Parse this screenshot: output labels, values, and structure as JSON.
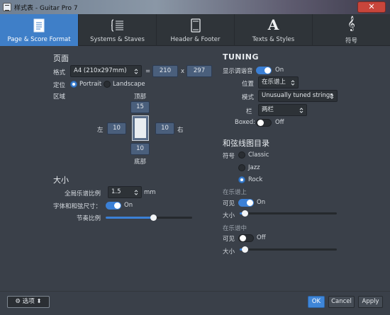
{
  "window": {
    "title": "样式表 - Guitar Pro 7"
  },
  "tabs": [
    {
      "label": "Page & Score Format",
      "icon": "page-icon"
    },
    {
      "label": "Systems & Staves",
      "icon": "systems-icon"
    },
    {
      "label": "Header & Footer",
      "icon": "header-footer-icon"
    },
    {
      "label": "Texts & Styles",
      "icon": "text-a-icon"
    },
    {
      "label": "符号",
      "icon": "treble-clef-icon"
    }
  ],
  "page": {
    "heading": "页面",
    "format_label": "格式",
    "format_value": "A4 (210x297mm)",
    "equals": "=",
    "width": "210",
    "times": "x",
    "height": "297",
    "orientation_label": "定位",
    "portrait": "Portrait",
    "landscape": "Landscape",
    "orientation_selected": "Portrait",
    "margins_label": "区域",
    "top_label": "顶部",
    "top": "15",
    "left_label": "左",
    "left": "10",
    "right_label": "右",
    "right": "10",
    "bottom_label": "底部",
    "bottom": "10"
  },
  "size": {
    "heading": "大小",
    "global_scale_label": "全局乐谱比例",
    "global_scale_value": "1.5",
    "global_scale_unit": "mm",
    "font_chord_label": "字体和和弦尺寸：",
    "font_chord_toggle": "On",
    "rhythm_ratio_label": "节奏比例",
    "rhythm_ratio_fraction": 0.55
  },
  "tuning": {
    "heading": "TUNING",
    "show_label": "显示调谐音",
    "show_toggle": "On",
    "position_label": "位置",
    "position_value": "在乐谱上",
    "mode_label": "模式",
    "mode_value": "Unusually tuned strings",
    "column_label": "栏",
    "column_value": "两栏",
    "boxed_label": "Boxed:",
    "boxed_toggle": "Off"
  },
  "chords": {
    "heading": "和弦线图目录",
    "symbol_label": "符号",
    "options": [
      "Classic",
      "Jazz",
      "Rock"
    ],
    "selected": "Rock",
    "on_score_heading": "在乐谱上",
    "on_score_visible_label": "可见",
    "on_score_visible_toggle": "On",
    "on_score_size_label": "大小",
    "on_score_size_fraction": 0.05,
    "in_score_heading": "在乐谱中",
    "in_score_visible_label": "可见",
    "in_score_visible_toggle": "Off",
    "in_score_size_label": "大小",
    "in_score_size_fraction": 0.05
  },
  "footer": {
    "options_label": "选项",
    "ok": "OK",
    "cancel": "Cancel",
    "apply": "Apply"
  },
  "colors": {
    "accent": "#3f86d8",
    "background": "#3a4049",
    "tabbar": "#2f3439"
  }
}
